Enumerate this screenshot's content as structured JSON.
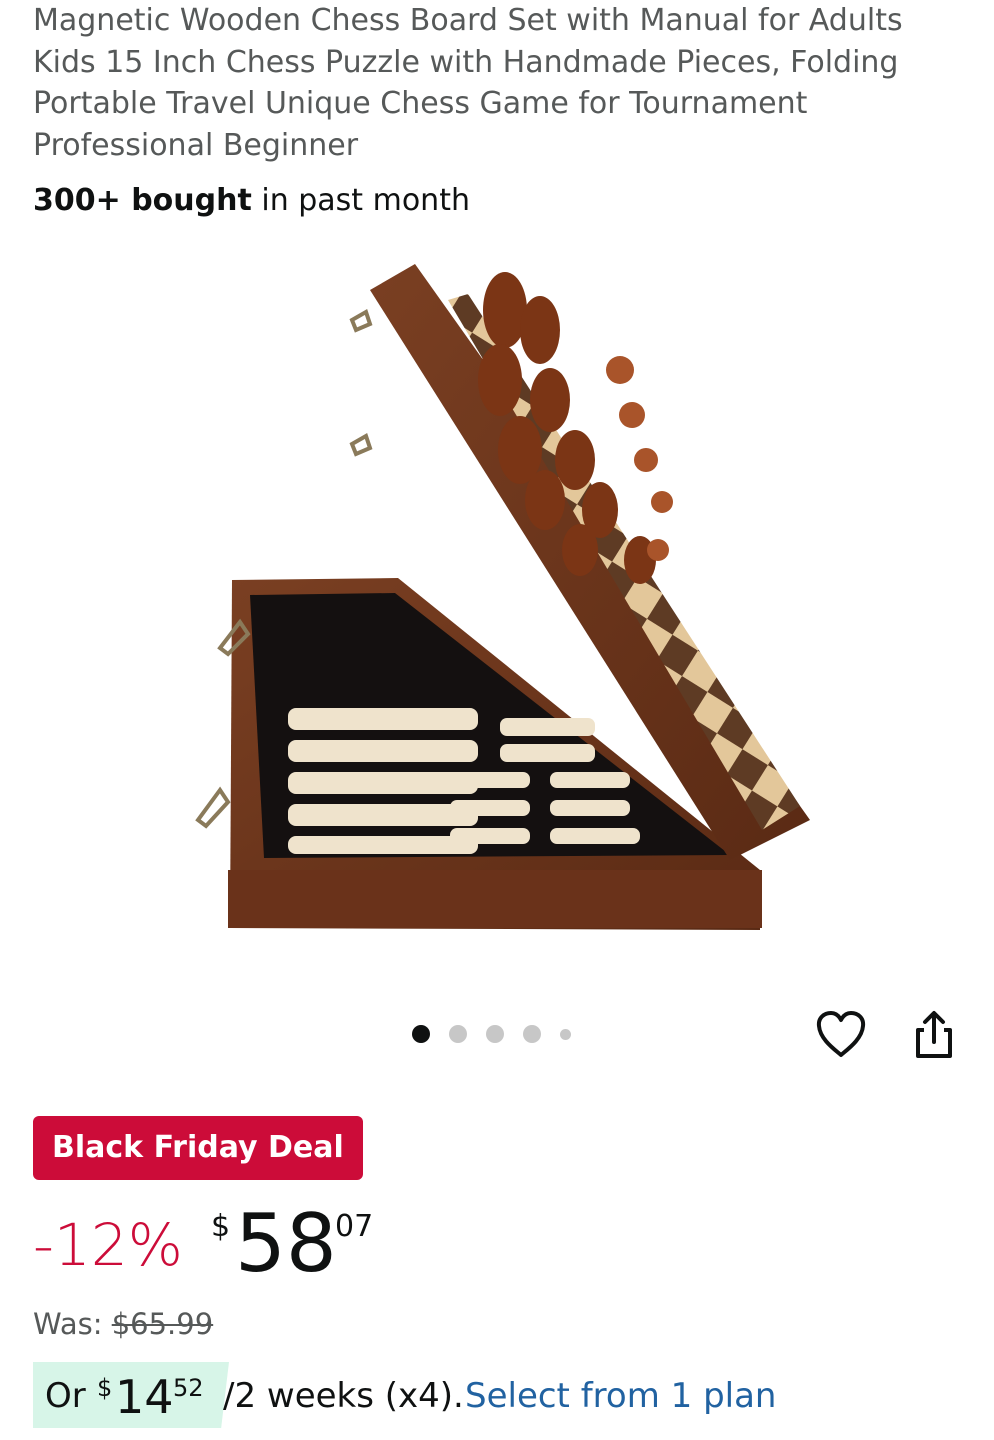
{
  "product": {
    "title": "Magnetic Wooden Chess Board Set with Manual for Adults Kids 15 Inch Chess Puzzle with Handmade Pieces, Folding Portable Travel Unique Chess Game for Tournament Professional Beginner",
    "bought_count": "300+ bought",
    "bought_suffix": " in past month"
  },
  "gallery": {
    "image_count": 5,
    "active_index": 0
  },
  "actions": {
    "wishlist_icon": "heart-icon",
    "share_icon": "share-icon"
  },
  "deal": {
    "badge_label": "Black Friday Deal",
    "badge_color": "#cc0c39"
  },
  "price": {
    "discount": "-12%",
    "currency": "$",
    "whole": "58",
    "fraction": "07",
    "was_label": "Was: ",
    "was_value": "$65.99"
  },
  "installment": {
    "prefix": "Or ",
    "currency": "$",
    "whole": "14",
    "fraction": "52",
    "period": "/2 weeks (x4).",
    "link_label": "Select from 1 plan",
    "highlight_color": "#d7f5e8",
    "link_color": "#2162a1"
  }
}
